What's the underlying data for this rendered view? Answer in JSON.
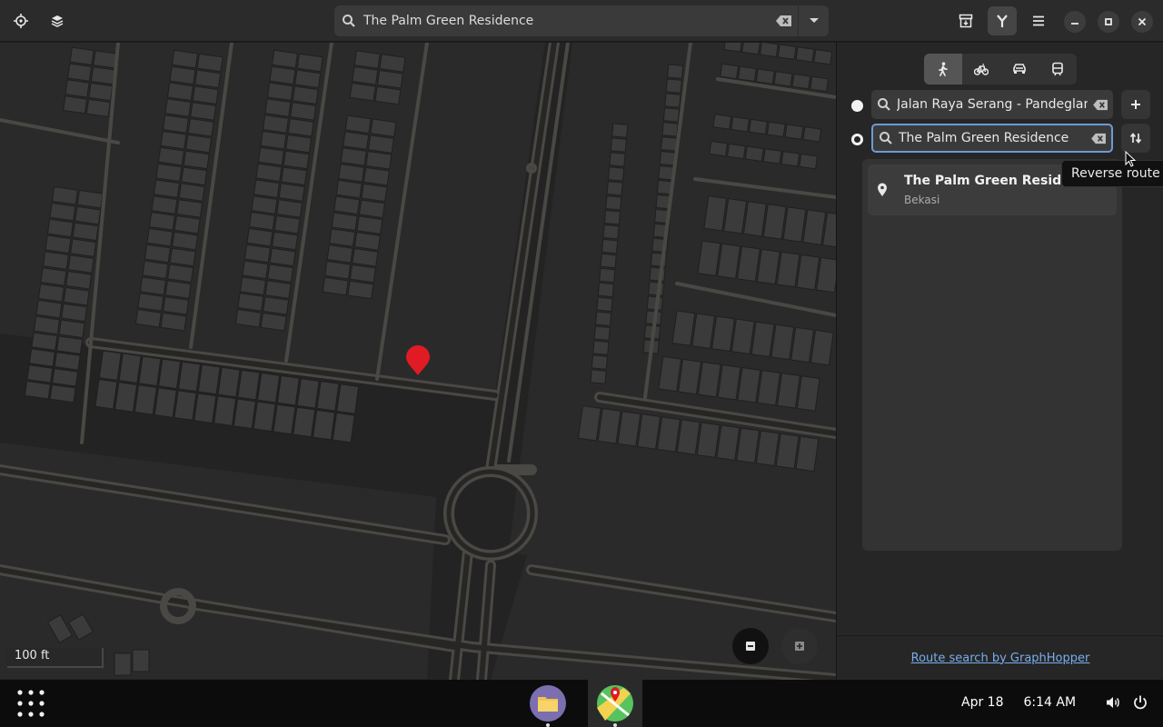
{
  "header": {
    "search_value": "The Palm Green Residence"
  },
  "map": {
    "scale_label": "100 ft"
  },
  "sidebar": {
    "modes": [
      "walk",
      "bike",
      "car",
      "transit"
    ],
    "active_mode": "walk",
    "route_from": "Jalan Raya Serang - Pandeglang",
    "route_to": "The Palm Green Residence",
    "result": {
      "title": "The Palm Green Residence",
      "subtitle": "Bekasi"
    },
    "tooltip": "Reverse route",
    "footer_link": "Route search by GraphHopper"
  },
  "taskbar": {
    "date": "Apr 18",
    "time": "6:14 AM"
  },
  "colors": {
    "accent": "#6a9bd8",
    "link": "#78aeed",
    "marker": "#e01b24"
  }
}
